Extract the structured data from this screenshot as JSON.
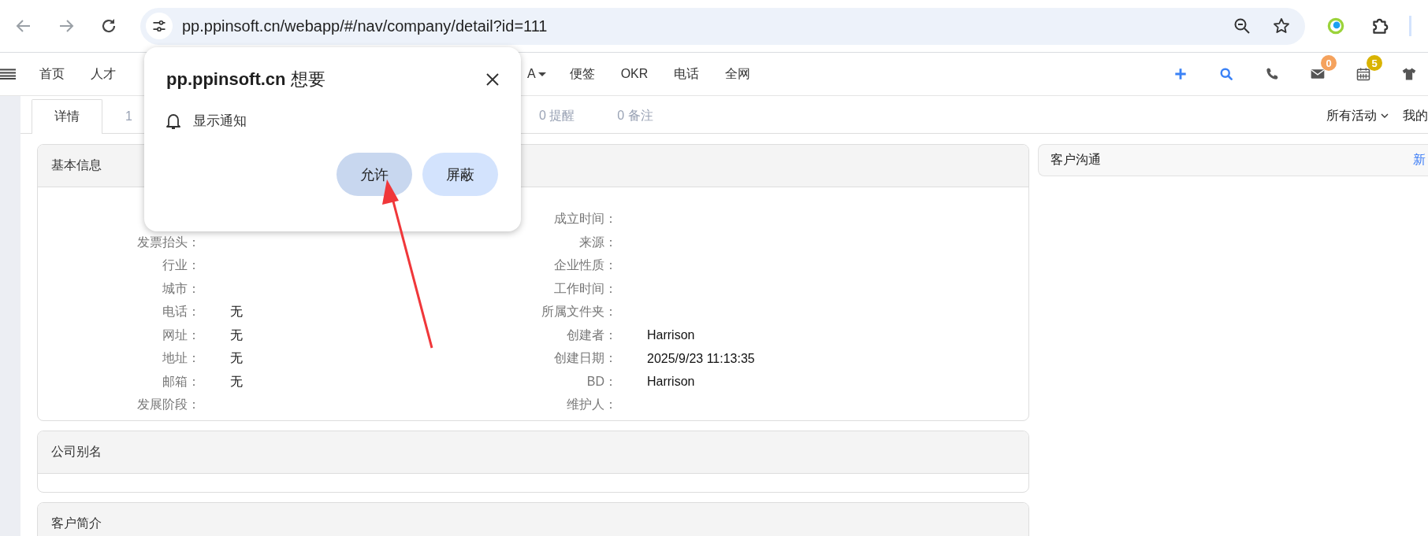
{
  "browser": {
    "url": "pp.ppinsoft.cn/webapp/#/nav/company/detail?id=111"
  },
  "nav": {
    "items": [
      {
        "label": "首页",
        "dropdown": false
      },
      {
        "label": "人才",
        "dropdown": false
      },
      {
        "label": "A",
        "dropdown": true
      },
      {
        "label": "便签",
        "dropdown": false
      },
      {
        "label": "OKR",
        "dropdown": false
      },
      {
        "label": "电话",
        "dropdown": false
      },
      {
        "label": "全网",
        "dropdown": false
      }
    ],
    "actions": [
      {
        "kind": "add"
      },
      {
        "kind": "search"
      },
      {
        "kind": "phone"
      },
      {
        "kind": "mail",
        "badge": "0",
        "color": "#f5a25d"
      },
      {
        "kind": "calendar",
        "badge": "5",
        "color": "#d9b300"
      },
      {
        "kind": "shirt"
      }
    ]
  },
  "tabs": [
    {
      "label": "详情",
      "selected": true
    },
    {
      "label": "1",
      "selected": false
    },
    {
      "label": "0 提醒",
      "selected": false
    },
    {
      "label": "0 备注",
      "selected": false
    }
  ],
  "activity_filter": {
    "label": "所有活动"
  },
  "activity_tab": {
    "label": "我的"
  },
  "basic_info": {
    "title": "基本信息",
    "rows": [
      {
        "right": {
          "label": "成立时间："
        }
      },
      {
        "left": {
          "label": "发票抬头："
        },
        "right": {
          "label": "来源："
        }
      },
      {
        "left": {
          "label": "行业："
        },
        "right": {
          "label": "企业性质："
        }
      },
      {
        "left": {
          "label": "城市："
        },
        "right": {
          "label": "工作时间："
        }
      },
      {
        "left": {
          "label": "电话：",
          "value": "无"
        },
        "right": {
          "label": "所属文件夹："
        }
      },
      {
        "left": {
          "label": "网址：",
          "value": "无"
        },
        "right": {
          "label": "创建者：",
          "value": "Harrison"
        }
      },
      {
        "left": {
          "label": "地址：",
          "value": "无"
        },
        "right": {
          "label": "创建日期：",
          "value": "2025/9/23 11:13:35"
        }
      },
      {
        "left": {
          "label": "邮箱：",
          "value": "无"
        },
        "right": {
          "label": "BD：",
          "value": "Harrison"
        }
      },
      {
        "left": {
          "label": "发展阶段："
        },
        "right": {
          "label": "维护人："
        }
      }
    ]
  },
  "alias_card": {
    "title": "公司别名"
  },
  "intro_card": {
    "title": "客户简介"
  },
  "communication": {
    "title": "客户沟通",
    "action": "新"
  },
  "permission_popup": {
    "title": "**pp.ppinsoft.cn** 想要",
    "permission": "显示通知",
    "buttons": [
      {
        "label": "允许",
        "kind": "primary"
      },
      {
        "label": "屏蔽",
        "kind": "secondary"
      }
    ]
  }
}
